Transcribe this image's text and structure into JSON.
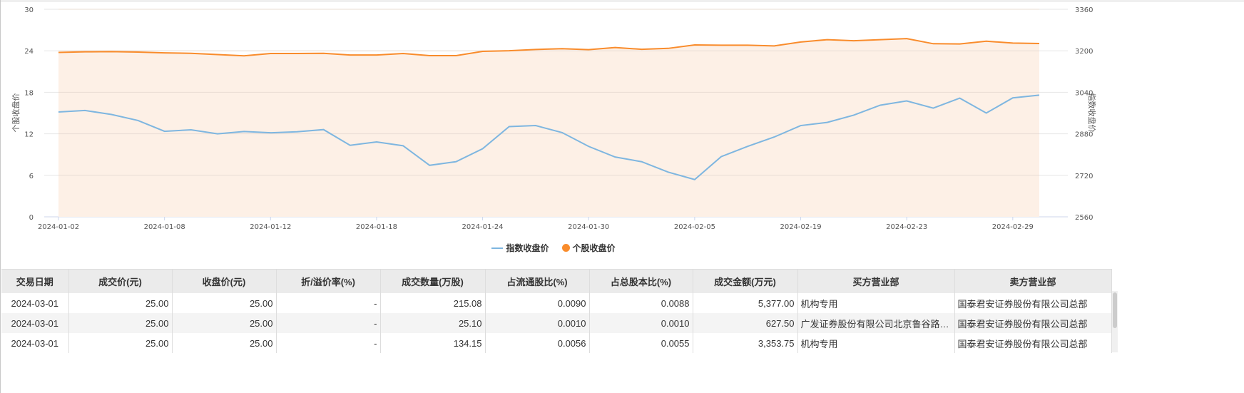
{
  "chart_data": {
    "type": "line",
    "title": "",
    "x": [
      "2024-01-02",
      "2024-01-03",
      "2024-01-04",
      "2024-01-05",
      "2024-01-08",
      "2024-01-09",
      "2024-01-10",
      "2024-01-11",
      "2024-01-12",
      "2024-01-15",
      "2024-01-16",
      "2024-01-17",
      "2024-01-18",
      "2024-01-19",
      "2024-01-22",
      "2024-01-23",
      "2024-01-24",
      "2024-01-25",
      "2024-01-26",
      "2024-01-29",
      "2024-01-30",
      "2024-01-31",
      "2024-02-01",
      "2024-02-02",
      "2024-02-05",
      "2024-02-06",
      "2024-02-07",
      "2024-02-08",
      "2024-02-19",
      "2024-02-20",
      "2024-02-21",
      "2024-02-22",
      "2024-02-23",
      "2024-02-26",
      "2024-02-27",
      "2024-02-28",
      "2024-02-29",
      "2024-03-01"
    ],
    "x_tick_labels": [
      "2024-01-02",
      "2024-01-08",
      "2024-01-12",
      "2024-01-18",
      "2024-01-24",
      "2024-01-30",
      "2024-02-05",
      "2024-02-19",
      "2024-02-23",
      "2024-02-29"
    ],
    "left_axis": {
      "label": "个股收盘价",
      "range": [
        0,
        30
      ],
      "ticks": [
        "0",
        "6",
        "12",
        "18",
        "24",
        "30"
      ]
    },
    "right_axis": {
      "label": "指数收盘价",
      "range": [
        2560,
        3360
      ],
      "ticks": [
        "2560",
        "2720",
        "2880",
        "3040",
        "3200",
        "3360"
      ]
    },
    "grid": true,
    "legend_position": "bottom-center",
    "series": [
      {
        "name": "指数收盘价",
        "axis": "right",
        "style": "line",
        "color": "#7eb6e0",
        "values": [
          2964,
          2970,
          2954.4,
          2931.4,
          2889.6,
          2895.4,
          2879.8,
          2888.8,
          2883.9,
          2888,
          2896.2,
          2835.6,
          2848.7,
          2834,
          2758.5,
          2772.5,
          2822.4,
          2907.7,
          2911.8,
          2884.7,
          2831.5,
          2790.5,
          2772.5,
          2732.3,
          2703.7,
          2792,
          2831.5,
          2867.6,
          2911.7,
          2924,
          2952,
          2990.3,
          3006.8,
          2979,
          3017.5,
          2960,
          3018.4,
          3029
        ]
      },
      {
        "name": "个股收盘价",
        "axis": "left",
        "style": "area",
        "color": "#f98c2c",
        "fill": "#fdf0e6",
        "values": [
          23.76,
          23.85,
          23.88,
          23.82,
          23.7,
          23.64,
          23.45,
          23.27,
          23.61,
          23.61,
          23.64,
          23.39,
          23.39,
          23.61,
          23.3,
          23.3,
          23.92,
          24.01,
          24.19,
          24.31,
          24.16,
          24.47,
          24.22,
          24.35,
          24.84,
          24.81,
          24.81,
          24.71,
          25.27,
          25.61,
          25.45,
          25.61,
          25.76,
          25.02,
          24.99,
          25.39,
          25.11,
          25.05
        ]
      }
    ]
  },
  "legend": {
    "index_label": "指数收盘价",
    "stock_label": "个股收盘价"
  },
  "table": {
    "headers": [
      "交易日期",
      "成交价(元)",
      "收盘价(元)",
      "折/溢价率(%)",
      "成交数量(万股)",
      "占流通股比(%)",
      "占总股本比(%)",
      "成交金额(万元)",
      "买方营业部",
      "卖方营业部"
    ],
    "rows": [
      [
        "2024-03-01",
        "25.00",
        "25.00",
        "-",
        "215.08",
        "0.0090",
        "0.0088",
        "5,377.00",
        "机构专用",
        "国泰君安证券股份有限公司总部"
      ],
      [
        "2024-03-01",
        "25.00",
        "25.00",
        "-",
        "25.10",
        "0.0010",
        "0.0010",
        "627.50",
        "广发证券股份有限公司北京鲁谷路证券营业部",
        "国泰君安证券股份有限公司总部"
      ],
      [
        "2024-03-01",
        "25.00",
        "25.00",
        "-",
        "134.15",
        "0.0056",
        "0.0055",
        "3,353.75",
        "机构专用",
        "国泰君安证券股份有限公司总部"
      ]
    ]
  }
}
